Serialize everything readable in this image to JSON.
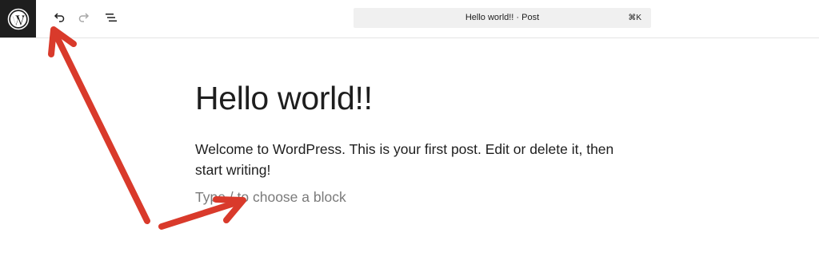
{
  "toolbar": {
    "logo_icon": "wordpress-logo-icon",
    "undo_icon": "undo-icon",
    "redo_icon": "redo-icon",
    "document_overview_icon": "list-view-icon",
    "command_bar_title": "Hello world!! · Post",
    "command_bar_shortcut": "⌘K"
  },
  "editor": {
    "post_title": "Hello world!!",
    "paragraph": "Welcome to WordPress. This is your first post. Edit or delete it, then start writing!",
    "block_placeholder": "Type / to choose a block"
  },
  "annotations": {
    "arrow_color": "#d93a2b",
    "arrow_count": 2
  },
  "colors": {
    "logo_background": "#1e1e1e",
    "command_bar_background": "#f0f0f0",
    "text": "#1e1e1e",
    "placeholder_text": "#7a7a7a"
  }
}
